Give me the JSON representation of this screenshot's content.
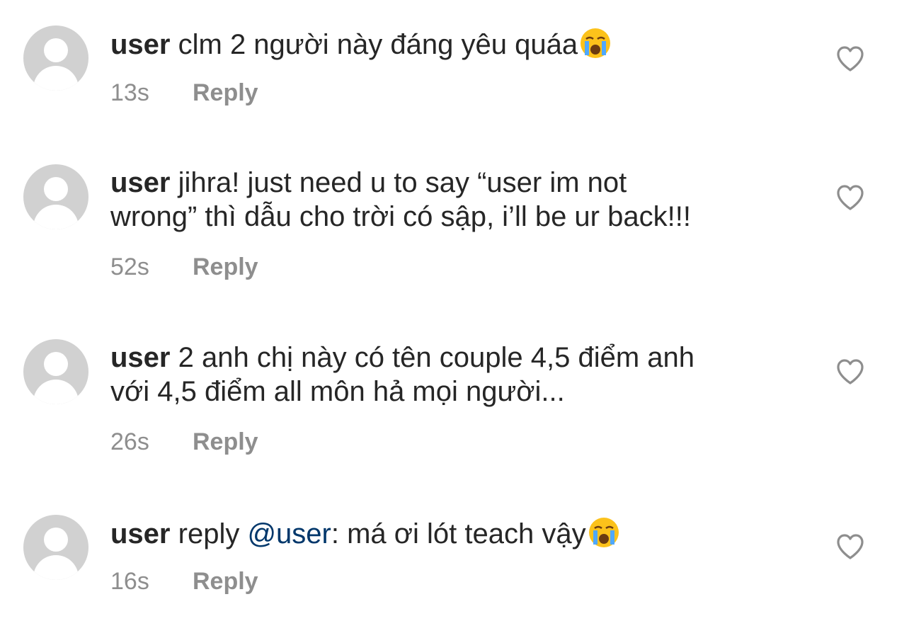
{
  "icons": {
    "avatar": "default-avatar-icon",
    "like": "heart-outline-icon",
    "emoji": "loudly-crying-face-emoji"
  },
  "colors": {
    "text": "#262626",
    "secondary": "#8e8e8e",
    "mention": "#00376b",
    "avatar_bg": "#d1d1d1"
  },
  "comments": [
    {
      "username": "user",
      "text_line1": "clm 2 người này đáng yêu quáa",
      "text_line2": "",
      "emoji": "😭",
      "time": "13s",
      "reply_label": "Reply"
    },
    {
      "username": "user",
      "text_line1": "jihra! just need u to say “user im not",
      "text_line2": "wrong” thì dẫu cho trời có sập, i’ll be ur back!!!",
      "time": "52s",
      "reply_label": "Reply"
    },
    {
      "username": "user",
      "text_line1": "2 anh chị này có tên couple 4,5 điểm anh",
      "text_line2": "với 4,5 điểm all môn hả mọi người...",
      "time": "26s",
      "reply_label": "Reply"
    },
    {
      "username": "user",
      "prefix": "reply",
      "mention": "@user",
      "text_after_mention": ": má ơi lót teach vậy",
      "emoji": "😭",
      "time": "16s",
      "reply_label": "Reply"
    }
  ]
}
